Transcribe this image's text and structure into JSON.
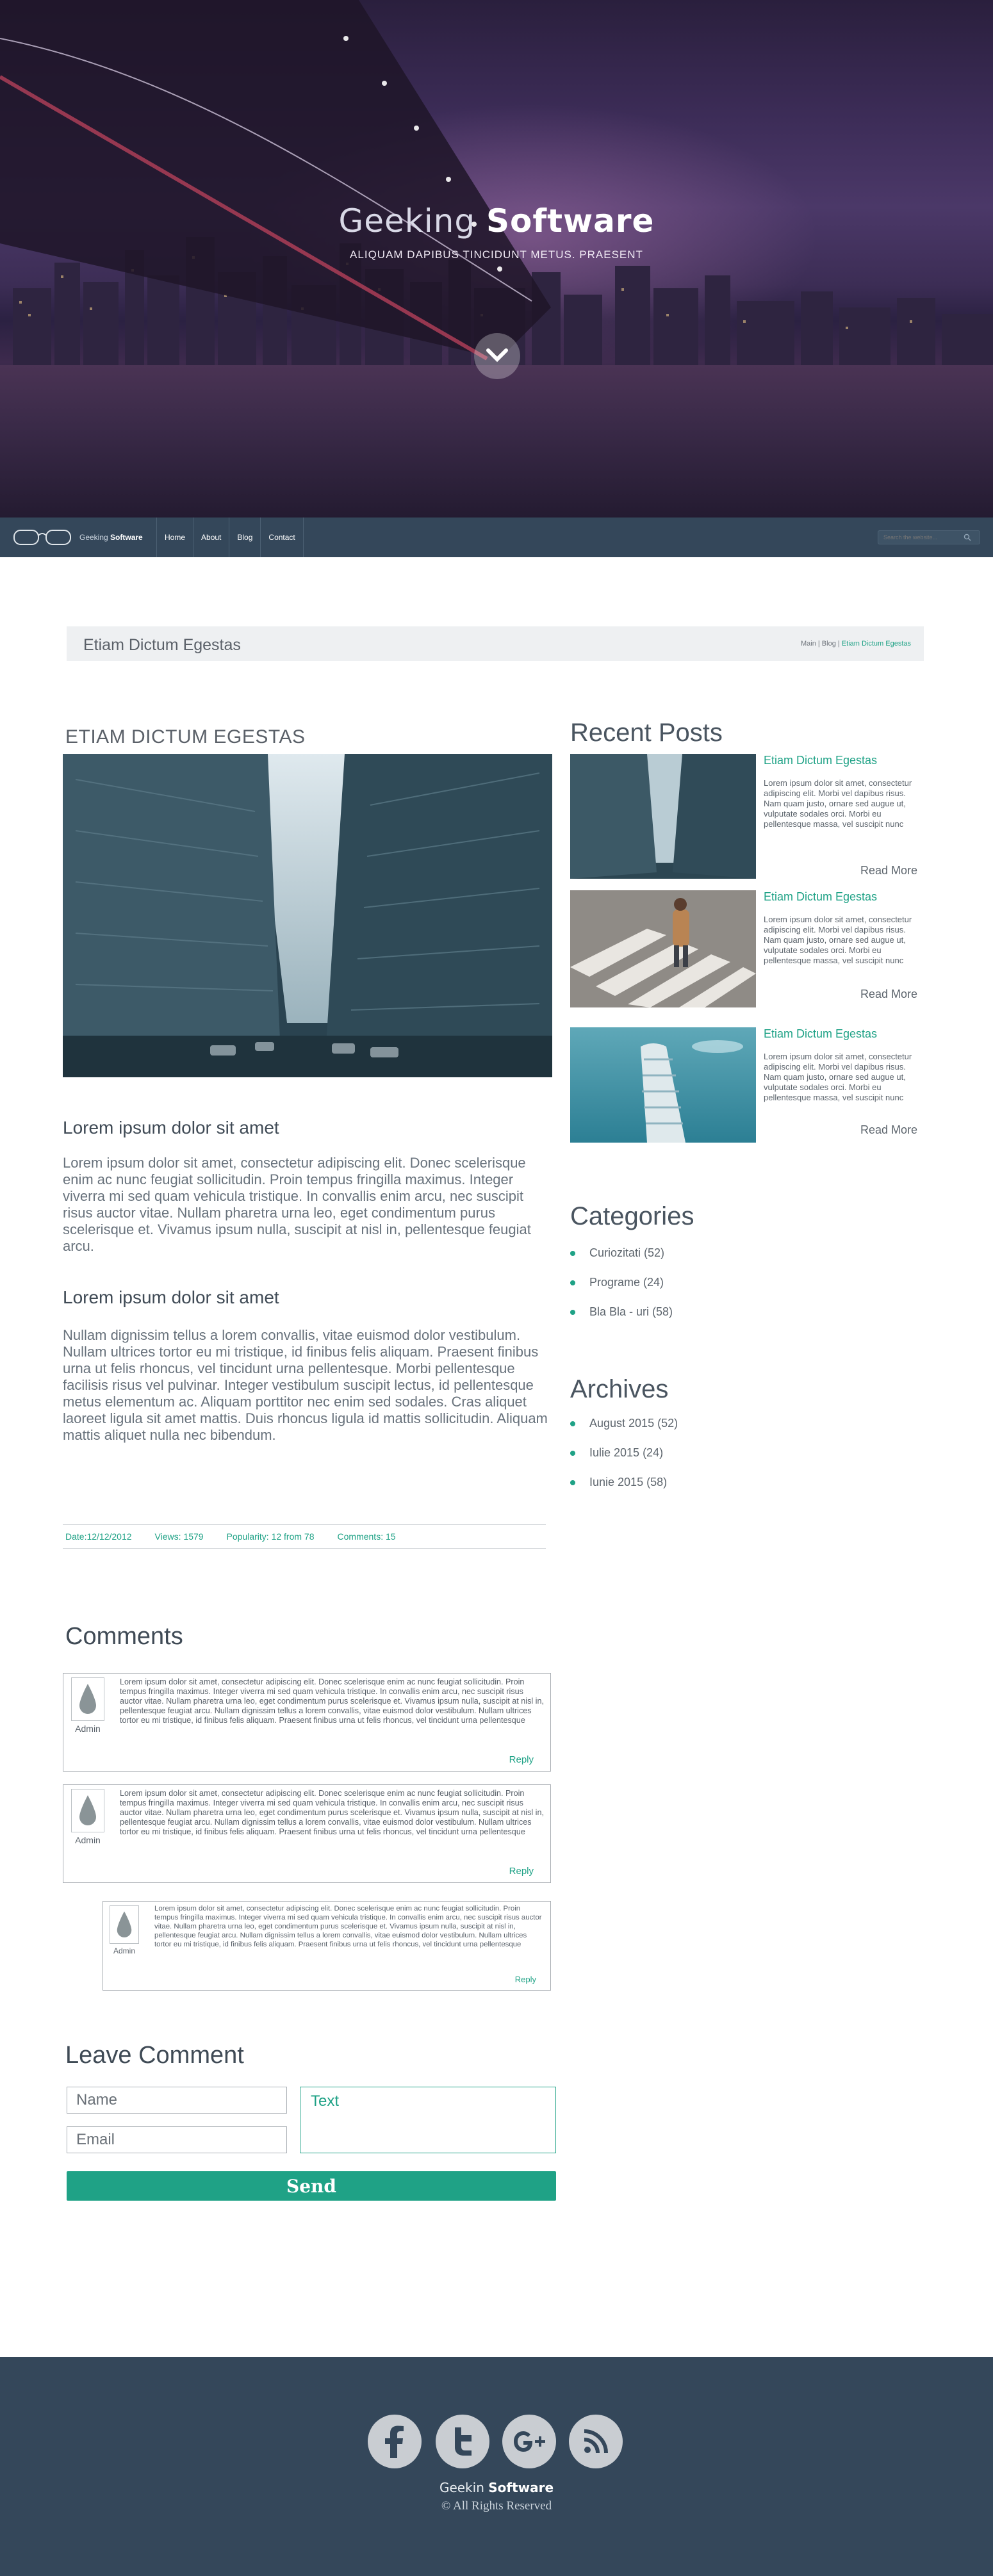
{
  "hero": {
    "title_light": "Geeking ",
    "title_bold": "Software",
    "subtitle": "ALIQUAM DAPIBUS TINCIDUNT METUS. PRAESENT",
    "scroll_icon": "chevron-down-icon"
  },
  "nav": {
    "logo_icon": "glasses-icon",
    "logo_light": "Geeking ",
    "logo_bold": "Software",
    "items": [
      {
        "label": "Home"
      },
      {
        "label": "About"
      },
      {
        "label": "Blog"
      },
      {
        "label": "Contact"
      }
    ],
    "search_placeholder": "Search the website...",
    "search_icon": "search-icon"
  },
  "page_header": {
    "title": "Etiam Dictum Egestas",
    "breadcrumb_prefix": "Main | Blog | ",
    "breadcrumb_current": "Etiam Dictum Egestas"
  },
  "article": {
    "title": "ETIAM DICTUM EGESTAS",
    "heading1": "Lorem ipsum dolor sit amet",
    "paragraph1": "Lorem ipsum dolor sit amet, consectetur adipiscing elit. Donec scelerisque enim ac nunc feugiat sollicitudin. Proin tempus fringilla maximus. Integer viverra mi sed quam vehicula tristique. In convallis enim arcu, nec suscipit risus auctor vitae. Nullam pharetra urna leo, eget condimentum purus scelerisque et. Vivamus ipsum nulla, suscipit at nisl in, pellentesque feugiat arcu.",
    "heading2": "Lorem ipsum dolor sit amet",
    "paragraph2": "Nullam dignissim tellus a lorem convallis, vitae euismod dolor vestibulum. Nullam ultrices tortor eu mi tristique, id finibus felis aliquam. Praesent finibus urna ut felis rhoncus, vel tincidunt urna pellentesque. Morbi pellentesque facilisis risus vel pulvinar. Integer vestibulum suscipit lectus, id pellentesque metus elementum ac. Aliquam porttitor nec enim sed sodales. Cras aliquet laoreet ligula sit amet mattis. Duis rhoncus ligula id mattis sollicitudin. Aliquam mattis aliquet nulla nec bibendum.",
    "meta": {
      "date": "Date:12/12/2012",
      "views": "Views: 1579",
      "popularity": "Popularity: 12 from 78",
      "comments": "Comments: 15"
    }
  },
  "sidebar": {
    "recent_title": "Recent Posts",
    "recent_posts": [
      {
        "title": "Etiam Dictum Egestas",
        "text": "Lorem ipsum dolor sit amet, consectetur adipiscing elit. Morbi vel dapibus risus. Nam quam justo, ornare sed augue ut, vulputate sodales orci. Morbi eu pellentesque massa, vel suscipit nunc",
        "more": "Read More"
      },
      {
        "title": "Etiam Dictum Egestas",
        "text": "Lorem ipsum dolor sit amet, consectetur adipiscing elit. Morbi vel dapibus risus. Nam quam justo, ornare sed augue ut, vulputate sodales orci. Morbi eu pellentesque massa, vel suscipit nunc",
        "more": "Read More"
      },
      {
        "title": "Etiam Dictum Egestas",
        "text": "Lorem ipsum dolor sit amet, consectetur adipiscing elit. Morbi vel dapibus risus. Nam quam justo, ornare sed augue ut, vulputate sodales orci. Morbi eu pellentesque massa, vel suscipit nunc",
        "more": "Read More"
      }
    ],
    "categories_title": "Categories",
    "categories": [
      {
        "label": "Curiozitati (52)"
      },
      {
        "label": "Programe (24)"
      },
      {
        "label": "Bla Bla - uri (58)"
      }
    ],
    "archives_title": "Archives",
    "archives": [
      {
        "label": "August 2015 (52)"
      },
      {
        "label": "Iulie 2015 (24)"
      },
      {
        "label": "Iunie 2015 (58)"
      }
    ]
  },
  "comments": {
    "title": "Comments",
    "items": [
      {
        "author": "Admin",
        "text": "Lorem ipsum dolor sit amet, consectetur adipiscing elit. Donec scelerisque enim ac nunc feugiat sollicitudin. Proin tempus fringilla maximus. Integer viverra mi sed quam vehicula tristique. In convallis enim arcu, nec suscipit risus auctor vitae. Nullam pharetra urna leo, eget condimentum purus scelerisque et. Vivamus ipsum nulla, suscipit at nisl in, pellentesque feugiat arcu. Nullam dignissim tellus a lorem convallis, vitae euismod dolor vestibulum. Nullam ultrices tortor eu mi tristique, id finibus felis aliquam. Praesent finibus urna ut felis rhoncus, vel tincidunt urna pellentesque",
        "reply": "Reply"
      },
      {
        "author": "Admin",
        "text": "Lorem ipsum dolor sit amet, consectetur adipiscing elit. Donec scelerisque enim ac nunc feugiat sollicitudin. Proin tempus fringilla maximus. Integer viverra mi sed quam vehicula tristique. In convallis enim arcu, nec suscipit risus auctor vitae. Nullam pharetra urna leo, eget condimentum purus scelerisque et. Vivamus ipsum nulla, suscipit at nisl in, pellentesque feugiat arcu. Nullam dignissim tellus a lorem convallis, vitae euismod dolor vestibulum. Nullam ultrices tortor eu mi tristique, id finibus felis aliquam. Praesent finibus urna ut felis rhoncus, vel tincidunt urna pellentesque",
        "reply": "Reply"
      },
      {
        "author": "Admin",
        "text": "Lorem ipsum dolor sit amet, consectetur adipiscing elit. Donec scelerisque enim ac nunc feugiat sollicitudin. Proin tempus fringilla maximus. Integer viverra mi sed quam vehicula tristique. In convallis enim arcu, nec suscipit risus auctor vitae. Nullam pharetra urna leo, eget condimentum purus scelerisque et. Vivamus ipsum nulla, suscipit at nisl in, pellentesque feugiat arcu. Nullam dignissim tellus a lorem convallis, vitae euismod dolor vestibulum. Nullam ultrices tortor eu mi tristique, id finibus felis aliquam. Praesent finibus urna ut felis rhoncus, vel tincidunt urna pellentesque",
        "reply": "Reply"
      }
    ]
  },
  "leave_comment": {
    "title": "Leave Comment",
    "name_placeholder": "Name",
    "email_placeholder": "Email",
    "text_placeholder": "Text",
    "send_label": "Send"
  },
  "footer": {
    "social_icons": [
      "facebook-icon",
      "twitter-icon",
      "google-plus-icon",
      "rss-icon"
    ],
    "brand_light": "Geekin ",
    "brand_bold": "Software",
    "copyright": "© All Rights Reserved"
  },
  "colors": {
    "accent": "#1fa286",
    "nav_bg": "#34475a",
    "page_bar_bg": "#eef0f2"
  }
}
